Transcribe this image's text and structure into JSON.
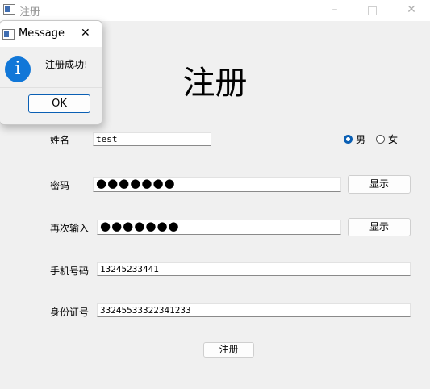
{
  "window": {
    "title": "注册",
    "min_glyph": "–",
    "close_glyph": "✕"
  },
  "form": {
    "heading": "注册",
    "name_label": "姓名",
    "name_value": "test",
    "gender_male": "男",
    "gender_female": "女",
    "gender_selected": "男",
    "password_label": "密码",
    "password_value": "●●●●●●●",
    "password_show_button": "显示",
    "confirm_label": "再次输入",
    "confirm_value": "●●●●●●●",
    "confirm_show_button": "显示",
    "phone_label": "手机号码",
    "phone_value": "13245233441",
    "id_label": "身份证号",
    "id_value": "332455333223412​33",
    "submit_button": "注册"
  },
  "dialog": {
    "title": "Message",
    "close_glyph": "✕",
    "message": "注册成功!",
    "icon": "information-icon",
    "icon_glyph": "i",
    "ok_button": "OK"
  },
  "colors": {
    "accent": "#0a5fb4",
    "info_icon": "#1177d8",
    "window_bg": "#f0f0f0"
  }
}
